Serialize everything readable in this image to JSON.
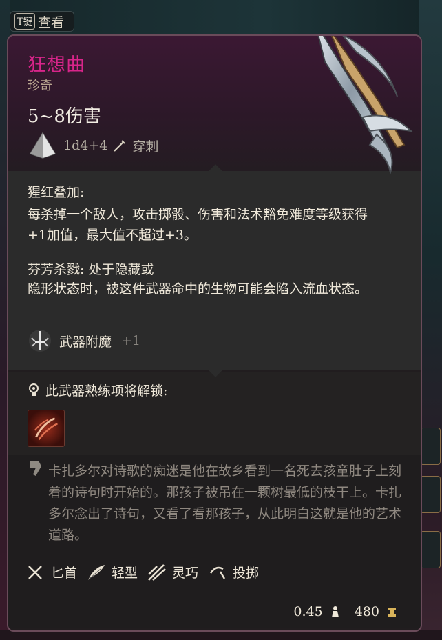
{
  "inspect_button": {
    "key": "T键",
    "label": "查看"
  },
  "item": {
    "name": "狂想曲",
    "rarity": "珍奇",
    "damage": "5~8伤害",
    "dice": "1d4+4",
    "damage_type": "穿刺"
  },
  "effects": [
    {
      "name": "猩红叠加:",
      "text": "每杀掉一个敌人，攻击掷骰、伤害和法术豁免难度等级获得+1加值，最大值不超过+3。"
    },
    {
      "name": "芬芳杀戮: 处于隐藏或",
      "text": "隐形状态时，被这件武器命中的生物可能会陷入流血状态。"
    }
  ],
  "enchantment": {
    "label": "武器附魔",
    "value": "+1"
  },
  "proficiency": {
    "header": "此武器熟练项将解锁:"
  },
  "lore": "卡扎多尔对诗歌的痴迷是他在故乡看到一名死去孩童肚子上刻着的诗句时开始的。那孩子被吊在一颗树最低的枝干上。卡扎多尔念出了诗句，又看了看那孩子，从此明白这就是他的艺术道路。",
  "tags": [
    "匕首",
    "轻型",
    "灵巧",
    "投掷"
  ],
  "footer": {
    "weight": "0.45",
    "price": "480"
  },
  "colors": {
    "name": "#d8258a",
    "border": "#6a4b5a",
    "text": "#f0e9da",
    "lore": "#8f8880"
  }
}
